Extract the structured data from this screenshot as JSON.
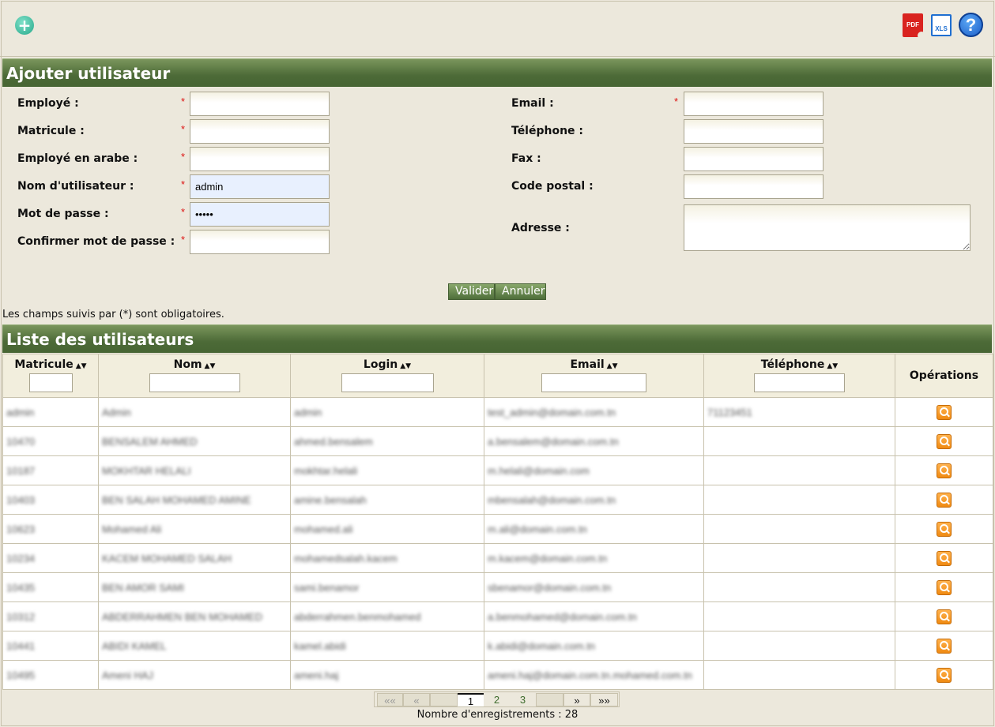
{
  "toolbar": {
    "add_icon": "plus-circle-icon",
    "pdf_label": "PDF",
    "xls_label": "XLS",
    "help_label": "?"
  },
  "form": {
    "title": "Ajouter utilisateur",
    "left_fields": [
      {
        "label": "Employé :",
        "value": ""
      },
      {
        "label": "Matricule :",
        "value": ""
      },
      {
        "label": "Employé en arabe :",
        "value": ""
      },
      {
        "label": "Nom d'utilisateur :",
        "value": "admin"
      },
      {
        "label": "Mot de passe :",
        "value": "•••••"
      },
      {
        "label": "Confirmer mot de passe :",
        "value": ""
      }
    ],
    "right_fields": [
      {
        "label": "Email :",
        "value": ""
      },
      {
        "label": "Téléphone :",
        "value": ""
      },
      {
        "label": "Fax :",
        "value": ""
      },
      {
        "label": "Code postal :",
        "value": ""
      },
      {
        "label": "Adresse :",
        "value": ""
      }
    ],
    "required_mark": "*",
    "submit_label": "Valider",
    "cancel_label": "Annuler",
    "note": "Les champs suivis par (*) sont obligatoires."
  },
  "list": {
    "title": "Liste des utilisateurs",
    "columns": [
      "Matricule",
      "Nom",
      "Login",
      "Email",
      "Téléphone",
      "Opérations"
    ],
    "sort_glyph": "▲▼",
    "rows": [
      [
        "admin",
        "Admin",
        "admin",
        "test_admin@domain.com.tn",
        "71123451"
      ],
      [
        "10470",
        "BENSALEM AHMED",
        "ahmed.bensalem",
        "a.bensalem@domain.com.tn",
        ""
      ],
      [
        "10187",
        "MOKHTAR HELALI",
        "mokhtar.helali",
        "m.helali@domain.com",
        ""
      ],
      [
        "10403",
        "BEN SALAH MOHAMED AMINE",
        "amine.bensalah",
        "mbensalah@domain.com.tn",
        ""
      ],
      [
        "10623",
        "Mohamed Ali",
        "mohamed.ali",
        "m.ali@domain.com.tn",
        ""
      ],
      [
        "10234",
        "KACEM MOHAMED SALAH",
        "mohamedsalah.kacem",
        "m.kacem@domain.com.tn",
        ""
      ],
      [
        "10435",
        "BEN AMOR SAMI",
        "sami.benamor",
        "sbenamor@domain.com.tn",
        ""
      ],
      [
        "10312",
        "ABDERRAHMEN BEN MOHAMED",
        "abderrahmen.benmohamed",
        "a.benmohamed@domain.com.tn",
        ""
      ],
      [
        "10441",
        "ABIDI KAMEL",
        "kamel.abidi",
        "k.abidi@domain.com.tn",
        ""
      ],
      [
        "10495",
        "Ameni HAJ",
        "ameni.haj",
        "ameni.haj@domain.com.tn.mohamed.com.tn",
        ""
      ]
    ],
    "pager": {
      "first": "««",
      "prev": "«",
      "pages": [
        "1",
        "2",
        "3"
      ],
      "next": "»",
      "last": "»»"
    },
    "count_text": "Nombre d'enregistrements : 28"
  }
}
